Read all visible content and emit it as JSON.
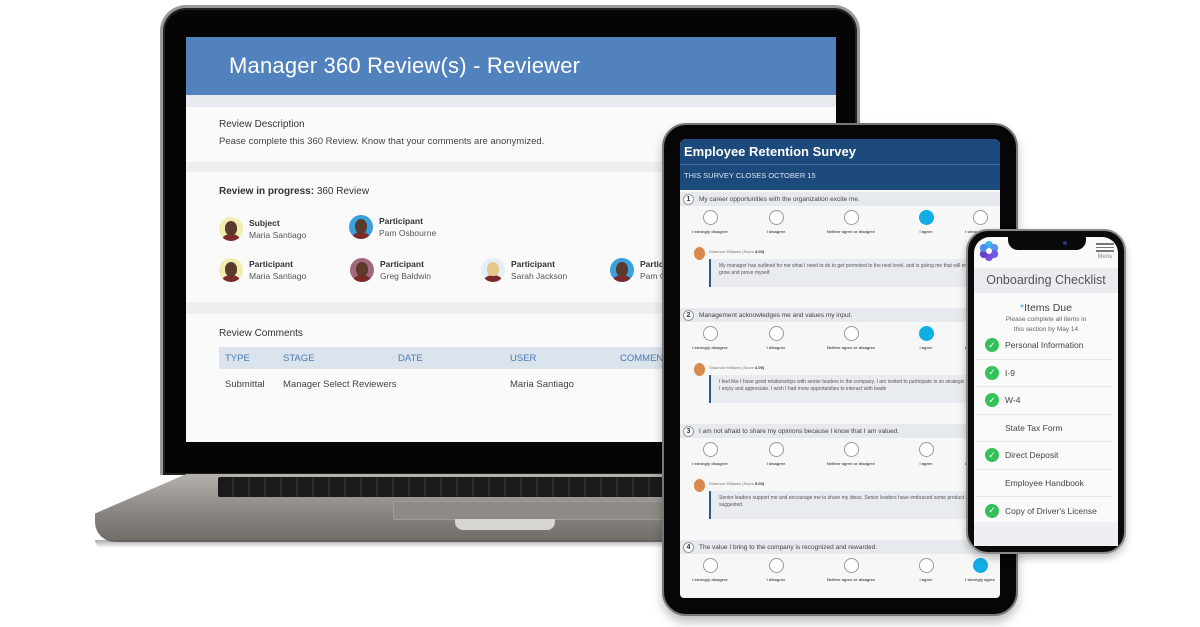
{
  "laptop": {
    "header_title": "Manager 360 Review(s) - Reviewer",
    "description": {
      "label": "Review Description",
      "text": "Pease complete this 360 Review. Know that your comments are anonymized."
    },
    "progress": {
      "label": "Review in progress:",
      "value": "360 Review"
    },
    "people": [
      {
        "role": "Subject",
        "name": "Maria Santiago"
      },
      {
        "role": "Participant",
        "name": "Pam Osbourne"
      },
      {
        "role": "Participant",
        "name": "Maria Santiago"
      },
      {
        "role": "Participant",
        "name": "Greg Baldwin"
      },
      {
        "role": "Participant",
        "name": "Sarah Jackson"
      },
      {
        "role": "Partic",
        "name": "Pam O"
      }
    ],
    "comments": {
      "label": "Review Comments",
      "columns": [
        "TYPE",
        "STAGE",
        "DATE",
        "USER",
        "COMMEN"
      ],
      "rows": [
        {
          "type": "Submittal",
          "stage": "Manager Select Reviewers",
          "date": "",
          "user": "Maria Santiago",
          "comment": ""
        }
      ]
    }
  },
  "tablet": {
    "title": "Employee Retention Survey",
    "closes": "THIS SURVEY CLOSES OCTOBER 15",
    "option_labels": [
      "I strongly disagree",
      "I disagree",
      "Neither agree or disagree",
      "I agree",
      "I strongly agree"
    ],
    "questions": [
      {
        "number": "1",
        "text": "My career opportunities with the organization excite me.",
        "selected": 3,
        "comment": {
          "author": "Shannon Williams (Score",
          "score": "4.00)",
          "text": "My manager has outlined for me what I need to do to get promoted to the next level, and is giving me that will enable me to grow and prove myself."
        }
      },
      {
        "number": "2",
        "text": "Management acknowledges me and values my input.",
        "selected": 3,
        "comment": {
          "author": "Shannon Williams (Score",
          "score": "4.00)",
          "text": "I feel like I have good relationships with senior leaders in the company. I am invited to participate in so strategic meetings which I enjoy and appreciate. I wish I had more opportunities to interact with leade"
        }
      },
      {
        "number": "3",
        "text": "I am not afraid to share my opinions because I know that I am valued.",
        "selected": -1,
        "comment": {
          "author": "Shannon Williams (Score",
          "score": "5.00)",
          "text": "Senior leaders support me and encourage me to share my ideas. Senior leaders have embraced some product ideas I've suggested."
        }
      },
      {
        "number": "4",
        "text": "The value I bring to the company is recognized and rewarded.",
        "selected": 4,
        "comment": null
      }
    ]
  },
  "phone": {
    "menu_label": "Menu",
    "title": "Onboarding Checklist",
    "due_star": "*",
    "due_title": "Items Due",
    "due_sub_1": "Please complete all items in",
    "due_sub_2": "this section by May 14",
    "items": [
      {
        "label": "Personal Information",
        "done": true
      },
      {
        "label": "I-9",
        "done": true
      },
      {
        "label": "W-4",
        "done": true
      },
      {
        "label": "State Tax Form",
        "done": false
      },
      {
        "label": "Direct Deposit",
        "done": true
      },
      {
        "label": "Employee Handbook",
        "done": false
      },
      {
        "label": "Copy of Driver's License",
        "done": true
      }
    ]
  },
  "colors": {
    "laptop_header": "#5282bd",
    "tablet_header": "#1d4a7c",
    "radio_selected": "#11aee6",
    "check_green": "#34c15a",
    "table_header_text": "#4a7ab5"
  }
}
